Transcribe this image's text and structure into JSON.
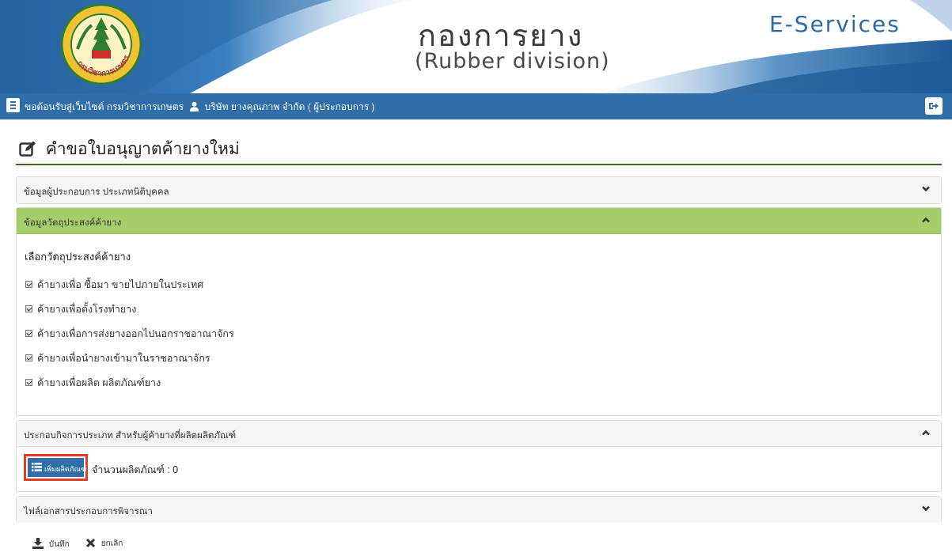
{
  "header": {
    "title_th": "กองการยาง",
    "title_en": "(Rubber division)",
    "service": "E-Services",
    "logo_text": "กรมวิชาการเกษตร"
  },
  "navbar": {
    "welcome": "ขอต้อนรับสู่เว็บไซต์ กรมวิชาการเกษตร",
    "user": "บริษัท ยางคุณภาพ จำกัด ( ผู้ประกอบการ )"
  },
  "page": {
    "title": "คำขอใบอนุญาตค้ายางใหม่"
  },
  "panels": [
    {
      "title": "ข้อมูลผู้ประกอบการ ประเภทนิติบุคคล",
      "expanded": false
    },
    {
      "title": "ข้อมูลวัตถุประสงค์ค้ายาง",
      "expanded": true
    },
    {
      "title": "ประกอบกิจการประเภท สำหรับผู้ค้ายางที่ผลิตผลิตภัณฑ์",
      "expanded": true
    },
    {
      "title": "ไฟล์เอกสารประกอบการพิจารณา",
      "expanded": false
    }
  ],
  "purpose": {
    "heading": "เลือกวัตถุประสงค์ค้ายาง",
    "options": [
      {
        "label": "ค้ายางเพื่อ ซื้อมา ขายไปภายในประเทศ",
        "checked": true
      },
      {
        "label": "ค้ายางเพื่อตั้งโรงทำยาง",
        "checked": true
      },
      {
        "label": "ค้ายางเพื่อการส่งยางออกไปนอกราชอาณาจักร",
        "checked": true
      },
      {
        "label": "ค้ายางเพื่อนำยางเข้ามาในราชอาณาจักร",
        "checked": true
      },
      {
        "label": "ค้ายางเพื่อผลิต ผลิตภัณฑ์ยาง",
        "checked": true
      }
    ]
  },
  "products": {
    "add_button": "เพิ่มผลิตภัณฑ์",
    "count_label": "จำนวนผลิตภัณฑ์ : 0"
  },
  "footer": {
    "save": "บันทึก",
    "cancel": "ยกเลิก"
  },
  "colors": {
    "nav_blue": "#2f6ea9",
    "active_panel_green": "#a7cc6a",
    "highlight_red": "#e23b22",
    "title_rule_green": "#3e6a1f"
  },
  "icons": [
    "menu-icon",
    "user-icon",
    "logout-icon",
    "edit-icon",
    "chevron-down-icon",
    "chevron-up-icon",
    "list-icon",
    "download-icon",
    "close-icon"
  ]
}
